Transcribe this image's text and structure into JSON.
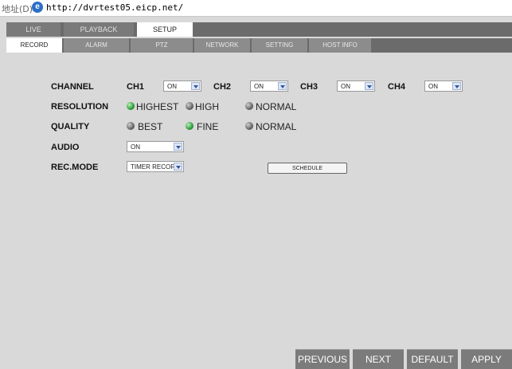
{
  "address_bar": {
    "label": "地址(D)",
    "url": "http://dvrtest05.eicp.net/"
  },
  "main_tabs": [
    {
      "label": "LIVE"
    },
    {
      "label": "PLAYBACK"
    },
    {
      "label": "SETUP"
    }
  ],
  "sub_tabs": [
    {
      "label": "RECORD"
    },
    {
      "label": "ALARM"
    },
    {
      "label": "PTZ"
    },
    {
      "label": "NETWORK"
    },
    {
      "label": "SETTING"
    },
    {
      "label": "HOST INFO"
    }
  ],
  "form": {
    "channel": {
      "label": "CHANNEL",
      "channels": [
        {
          "name": "CH1",
          "value": "ON"
        },
        {
          "name": "CH2",
          "value": "ON"
        },
        {
          "name": "CH3",
          "value": "ON"
        },
        {
          "name": "CH4",
          "value": "ON"
        }
      ]
    },
    "resolution": {
      "label": "RESOLUTION",
      "options": [
        {
          "label": "HIGHEST",
          "selected": true
        },
        {
          "label": "HIGH",
          "selected": false
        },
        {
          "label": "NORMAL",
          "selected": false
        }
      ]
    },
    "quality": {
      "label": "QUALITY",
      "options": [
        {
          "label": "BEST",
          "selected": false
        },
        {
          "label": "FINE",
          "selected": true
        },
        {
          "label": "NORMAL",
          "selected": false
        }
      ]
    },
    "audio": {
      "label": "AUDIO",
      "value": "ON"
    },
    "rec_mode": {
      "label": "REC.MODE",
      "value": "TIMER RECORD"
    },
    "schedule_label": "SCHEDULE"
  },
  "buttons": {
    "previous": "PREVIOUS",
    "next": "NEXT",
    "default": "DEFAULT",
    "apply": "APPLY"
  },
  "colors": {
    "background": "#d9d9d9",
    "tab_bar": "#6b6b6b",
    "active_tab": "#ffffff",
    "radio_on": "#2e9a3a",
    "radio_off": "#555555",
    "bottom_button": "#7b7b7b"
  }
}
